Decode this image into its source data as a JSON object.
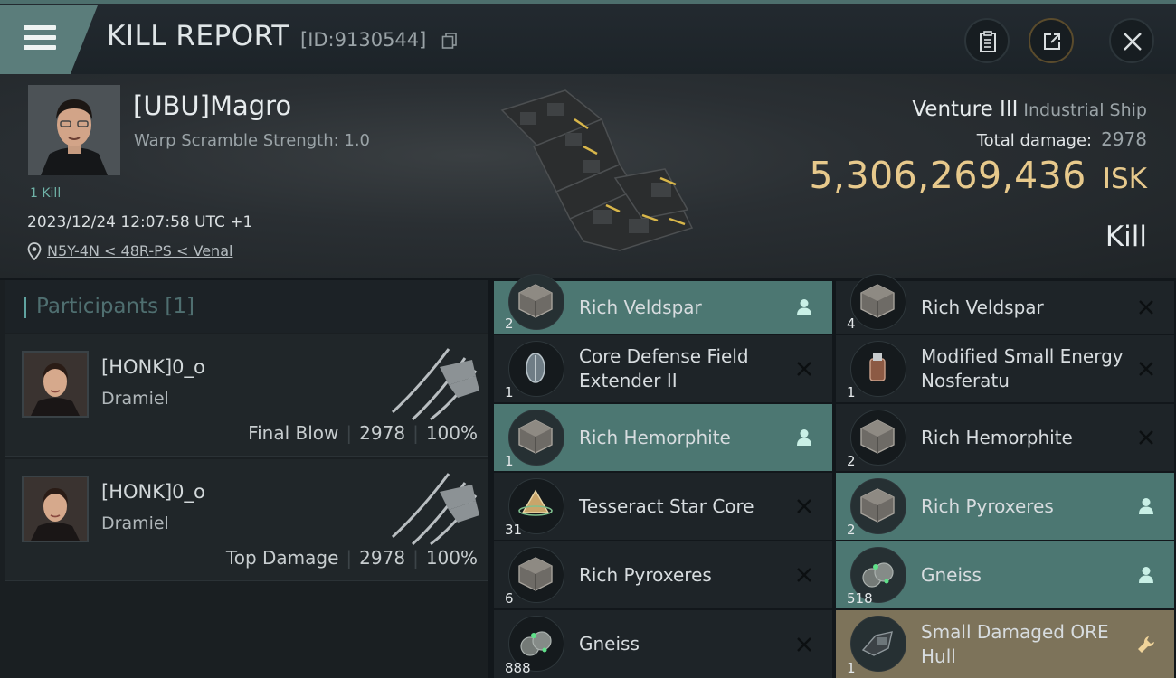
{
  "header": {
    "title": "KILL REPORT",
    "report_id": "[ID:9130544]",
    "icons": [
      "menu-icon",
      "copy-icon",
      "clipboard-icon",
      "share-icon",
      "close-icon"
    ]
  },
  "victim": {
    "name": "[UBU]Magro",
    "warp_scramble": "Warp Scramble Strength: 1.0",
    "kills": "1 Kill",
    "time": "2023/12/24 12:07:58 UTC +1",
    "location": "N5Y-4N < 48R-PS < Venal"
  },
  "ship": {
    "name": "Venture III",
    "class": "Industrial Ship",
    "total_damage_label": "Total damage:",
    "total_damage": "2978",
    "isk_value": "5,306,269,436",
    "isk_unit": "ISK",
    "result": "Kill"
  },
  "participants": {
    "title": "Participants [1]",
    "list": [
      {
        "name": "[HONK]0_o",
        "ship": "Dramiel",
        "role": "Final Blow",
        "damage": "2978",
        "percent": "100%"
      },
      {
        "name": "[HONK]0_o",
        "ship": "Dramiel",
        "role": "Top Damage",
        "damage": "2978",
        "percent": "100%"
      }
    ]
  },
  "items": [
    {
      "name": "Rich Veldspar",
      "qty": "2",
      "state": "dropped",
      "icon": "ore-cube-icon",
      "status_icon": "person-icon"
    },
    {
      "name": "Rich Veldspar",
      "qty": "4",
      "state": "destroyed",
      "icon": "ore-cube-icon",
      "status_icon": "x-icon"
    },
    {
      "name": "Core Defense Field Extender II",
      "qty": "1",
      "state": "destroyed",
      "icon": "shield-extender-icon",
      "status_icon": "x-icon"
    },
    {
      "name": "Modified Small Energy Nosferatu",
      "qty": "1",
      "state": "destroyed",
      "icon": "nosferatu-icon",
      "status_icon": "x-icon"
    },
    {
      "name": "Rich Hemorphite",
      "qty": "1",
      "state": "dropped",
      "icon": "ore-cube-icon",
      "status_icon": "person-icon"
    },
    {
      "name": "Rich Hemorphite",
      "qty": "2",
      "state": "destroyed",
      "icon": "ore-cube-icon",
      "status_icon": "x-icon"
    },
    {
      "name": "Tesseract Star Core",
      "qty": "31",
      "state": "destroyed",
      "icon": "star-core-icon",
      "status_icon": "x-icon"
    },
    {
      "name": "Rich Pyroxeres",
      "qty": "2",
      "state": "dropped",
      "icon": "ore-cube-icon",
      "status_icon": "person-icon"
    },
    {
      "name": "Rich Pyroxeres",
      "qty": "6",
      "state": "destroyed",
      "icon": "ore-cube-icon",
      "status_icon": "x-icon"
    },
    {
      "name": "Gneiss",
      "qty": "518",
      "state": "dropped",
      "icon": "gneiss-ore-icon",
      "status_icon": "person-icon"
    },
    {
      "name": "Gneiss",
      "qty": "888",
      "state": "destroyed",
      "icon": "gneiss-ore-icon",
      "status_icon": "x-icon"
    },
    {
      "name": "Small Damaged ORE Hull",
      "qty": "1",
      "state": "fitted",
      "icon": "ore-hull-icon",
      "status_icon": "wrench-icon"
    }
  ]
}
